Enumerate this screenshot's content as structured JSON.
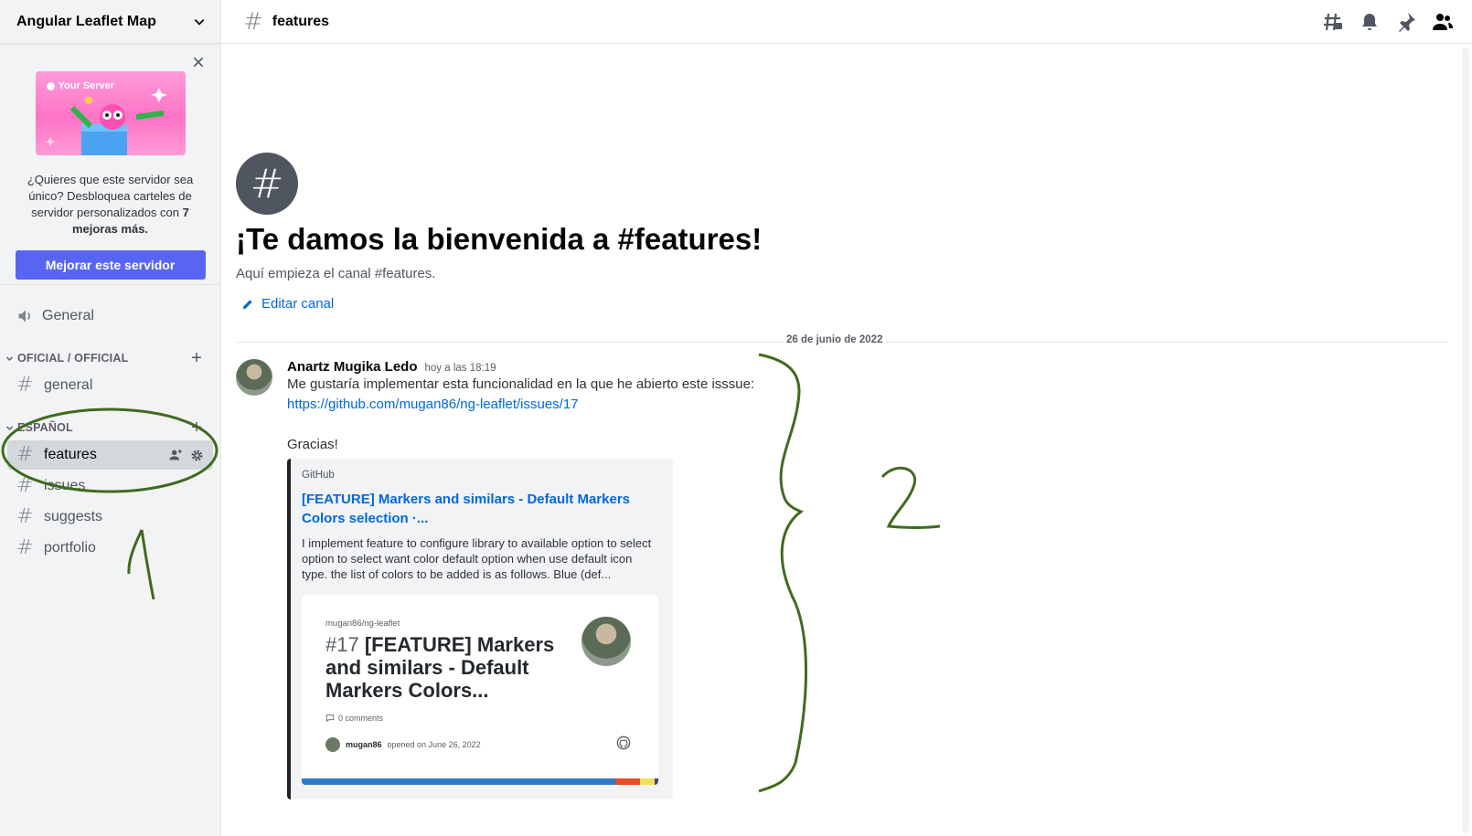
{
  "server": {
    "name": "Angular Leaflet Map"
  },
  "boost": {
    "art_label": "Your Server",
    "text_part1": "¿Quieres que este servidor sea único? Desbloquea carteles de servidor personalizados con ",
    "text_bold": "7 mejoras más.",
    "button_label": "Mejorar este servidor"
  },
  "sidebar": {
    "voice_channel": "General",
    "categories": [
      {
        "label": "OFICIAL / OFFICIAL",
        "channels": [
          "general"
        ]
      },
      {
        "label": "ESPAÑOL",
        "channels": [
          "features",
          "issues",
          "suggests",
          "portfolio"
        ]
      }
    ],
    "active_channel": "features"
  },
  "topbar": {
    "channel_name": "features"
  },
  "welcome": {
    "title": "¡Te damos la bienvenida a #features!",
    "subtitle": "Aquí empieza el canal #features.",
    "edit_label": "Editar canal"
  },
  "divider_date": "26 de junio de 2022",
  "message": {
    "author": "Anartz Mugika Ledo",
    "time": "hoy a las 18:19",
    "line1": "Me gustaría implementar esta funcionalidad en la que he abierto este isssue:",
    "link": "https://github.com/mugan86/ng-leaflet/issues/17",
    "thanks": "Gracias!"
  },
  "embed": {
    "provider": "GitHub",
    "title": "[FEATURE] Markers and similars - Default Markers Colors selection ·...",
    "description": "I implement feature to configure library to available option to select option to select want color default option when use default icon type. the list of colors to be added is as follows. Blue (def...",
    "og_repo": "mugan86/ng-leaflet",
    "og_number": "#17",
    "og_title": "[FEATURE] Markers and similars - Default Markers Colors...",
    "og_comments": "0 comments",
    "og_user": "mugan86",
    "og_opened": "opened on June 26, 2022",
    "lang_colors": [
      "#3178c6",
      "#e34c26",
      "#f1e05a",
      "#563d7c"
    ]
  },
  "annotations": {
    "color": "#3f6b1f"
  }
}
